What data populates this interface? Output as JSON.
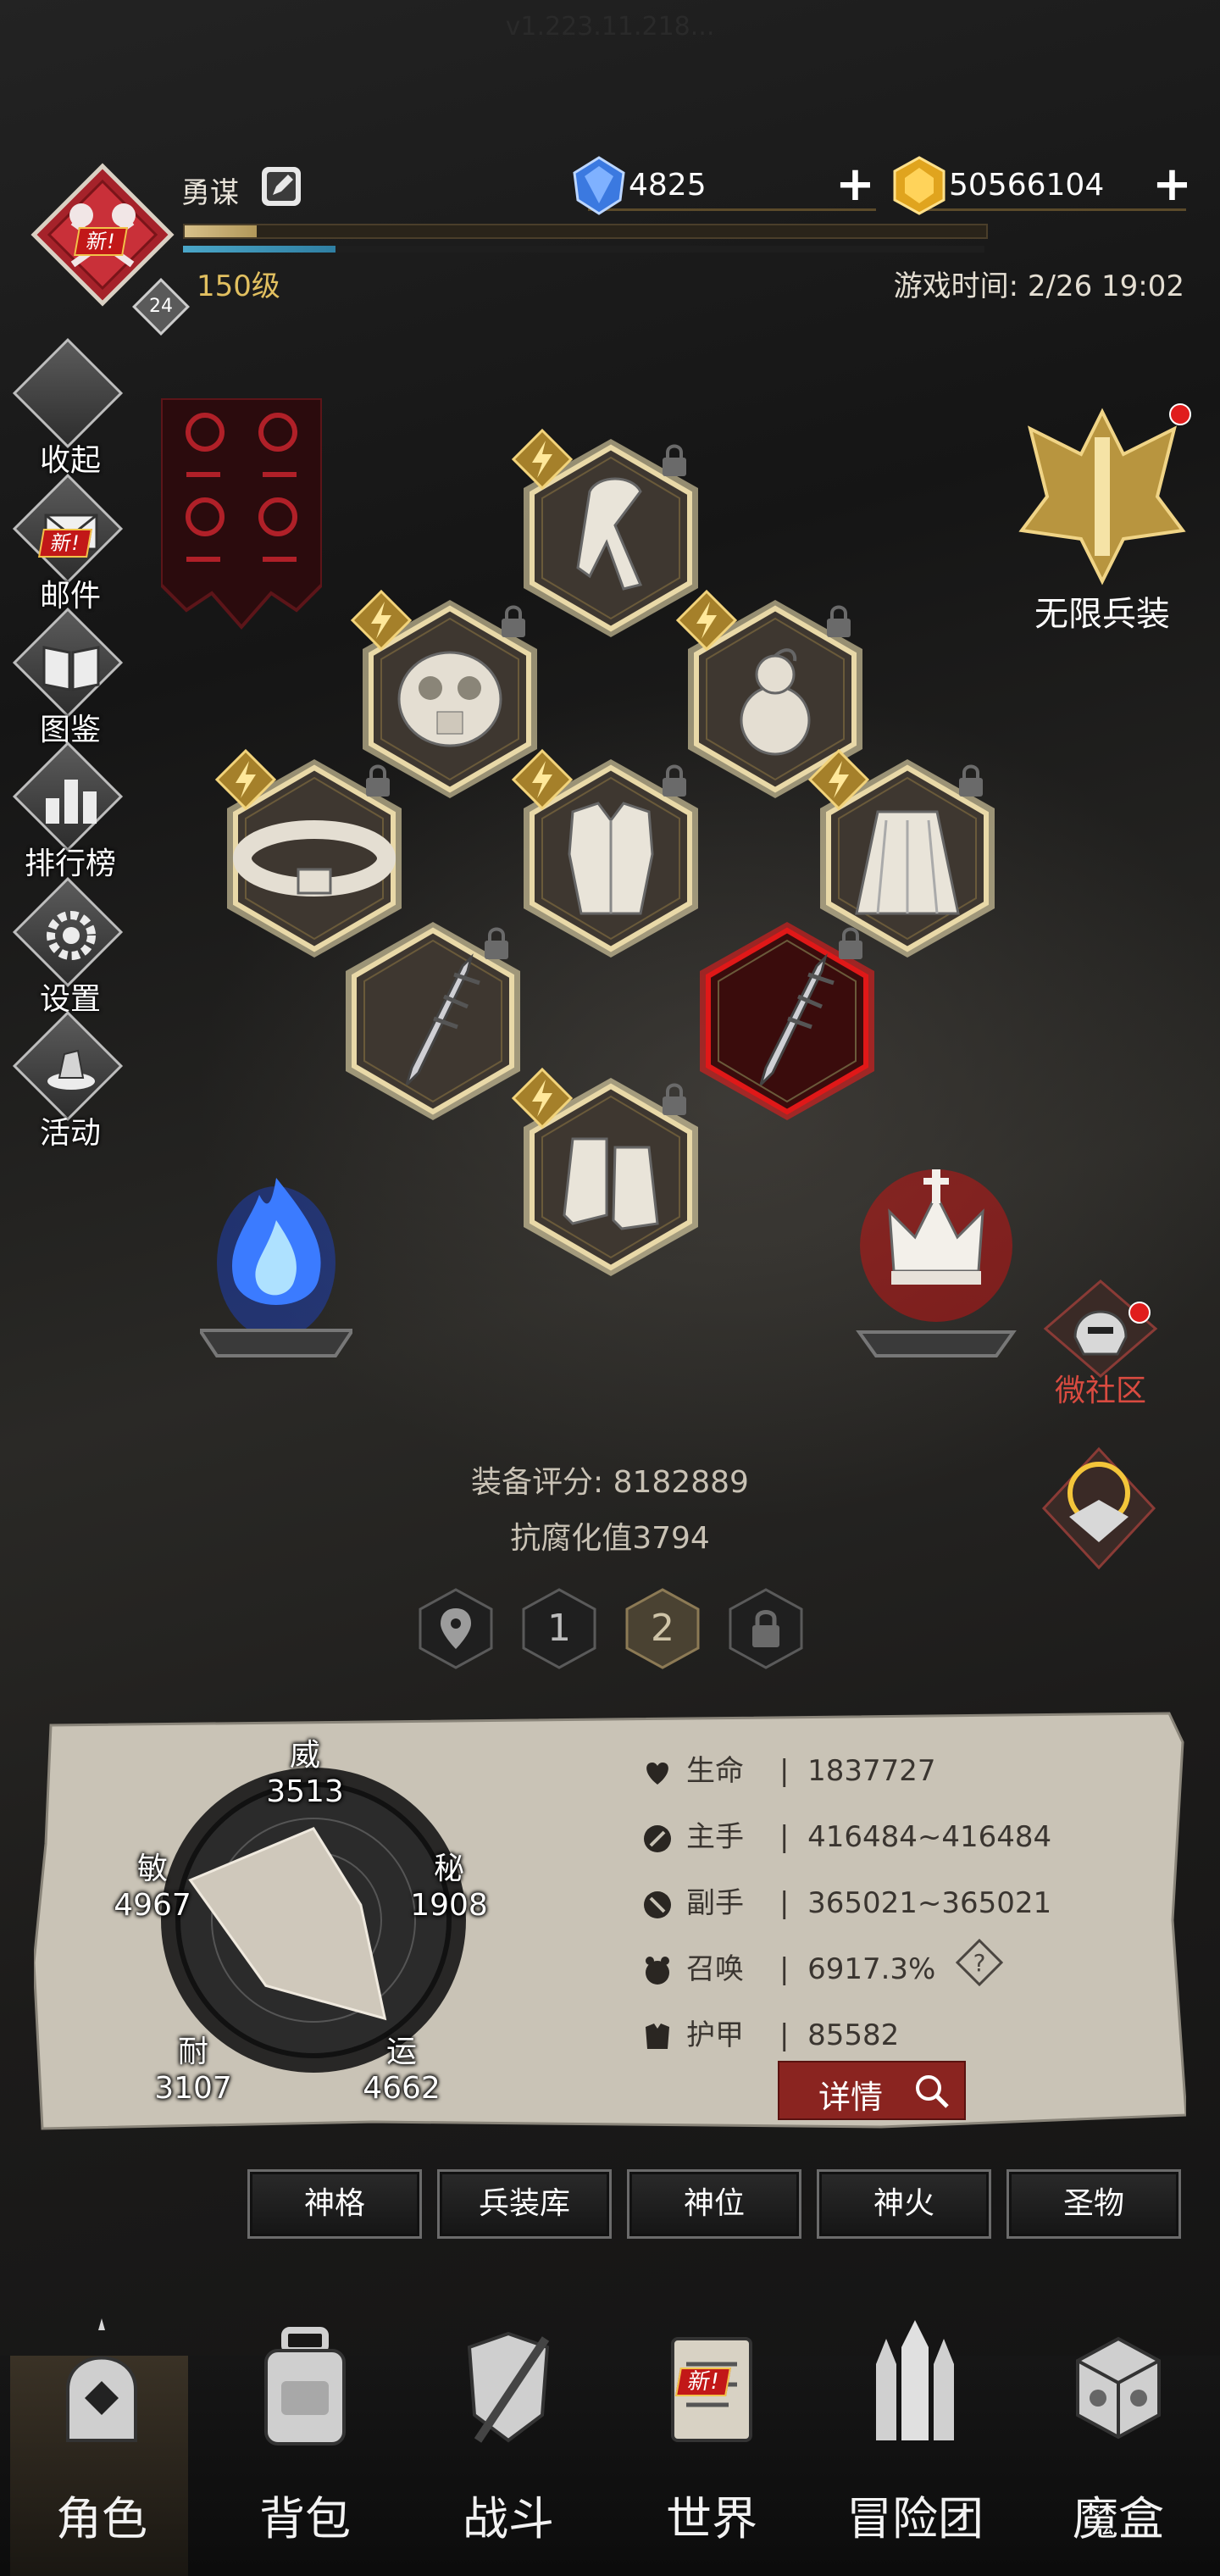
{
  "version": "v1.223.11.218...",
  "header": {
    "player_name": "勇谋",
    "player_level": "150级",
    "avatar_badge": "新!",
    "avatar_level": "24",
    "game_time": "游戏时间: 2/26 19:02",
    "gem_value": "4825",
    "gold_value": "50566104",
    "exp_fraction": 0.09,
    "bar2_fraction": 0.19
  },
  "side_menu": [
    {
      "label": "收起",
      "icon": "collapse-icon"
    },
    {
      "label": "邮件",
      "icon": "mail-icon",
      "badge": "新!"
    },
    {
      "label": "图鉴",
      "icon": "book-icon"
    },
    {
      "label": "排行榜",
      "icon": "ranking-icon"
    },
    {
      "label": "设置",
      "icon": "gear-icon"
    },
    {
      "label": "活动",
      "icon": "activity-icon"
    }
  ],
  "right_menu": {
    "infinite_gear": "无限兵装",
    "community": "微社区"
  },
  "equipment": {
    "score_label": "装备评分: 8182889",
    "corruption_label": "抗腐化值3794",
    "pages": [
      "1",
      "2"
    ],
    "active_page": "2"
  },
  "radar": {
    "labels": [
      {
        "name": "威",
        "value": "3513"
      },
      {
        "name": "秘",
        "value": "1908"
      },
      {
        "name": "运",
        "value": "4662"
      },
      {
        "name": "耐",
        "value": "3107"
      },
      {
        "name": "敏",
        "value": "4967"
      }
    ]
  },
  "stats": [
    {
      "name": "生命",
      "value": "1837727",
      "icon": "heart-icon"
    },
    {
      "name": "主手",
      "value": "416484~416484",
      "icon": "sword-icon"
    },
    {
      "name": "副手",
      "value": "365021~365021",
      "icon": "dagger-icon"
    },
    {
      "name": "召唤",
      "value": "6917.3%",
      "icon": "summon-icon"
    },
    {
      "name": "护甲",
      "value": "85582",
      "icon": "armor-icon"
    }
  ],
  "detail_button": "详情",
  "tabs": [
    "神格",
    "兵装库",
    "神位",
    "神火",
    "圣物"
  ],
  "nav": [
    {
      "label": "角色",
      "icon": "character-icon",
      "active": true
    },
    {
      "label": "背包",
      "icon": "backpack-icon"
    },
    {
      "label": "战斗",
      "icon": "battle-icon"
    },
    {
      "label": "世界",
      "icon": "world-icon",
      "badge": "新!"
    },
    {
      "label": "冒险团",
      "icon": "guild-icon"
    },
    {
      "label": "魔盒",
      "icon": "magic-box-icon"
    }
  ]
}
